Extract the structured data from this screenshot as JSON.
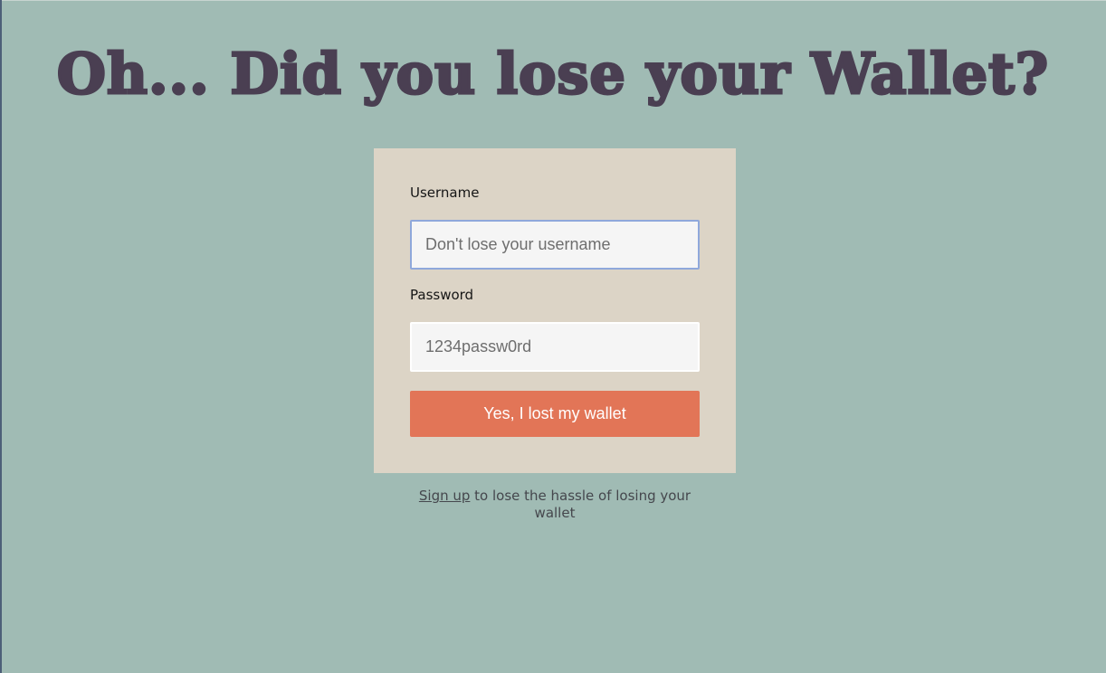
{
  "page": {
    "title": "Oh... Did you lose your Wallet?"
  },
  "form": {
    "username_label": "Username",
    "username_placeholder": "Don't lose your username",
    "username_value": "",
    "password_label": "Password",
    "password_value": "1234passw0rd",
    "submit_label": "Yes, I lost my wallet"
  },
  "footer": {
    "signup_link": "Sign up",
    "signup_text": " to lose the hassle of losing your wallet"
  },
  "colors": {
    "background": "#a0bbb4",
    "title": "#4a3f52",
    "card": "#dcd4c6",
    "button": "#e27557",
    "focus_border": "#8fa8db"
  }
}
